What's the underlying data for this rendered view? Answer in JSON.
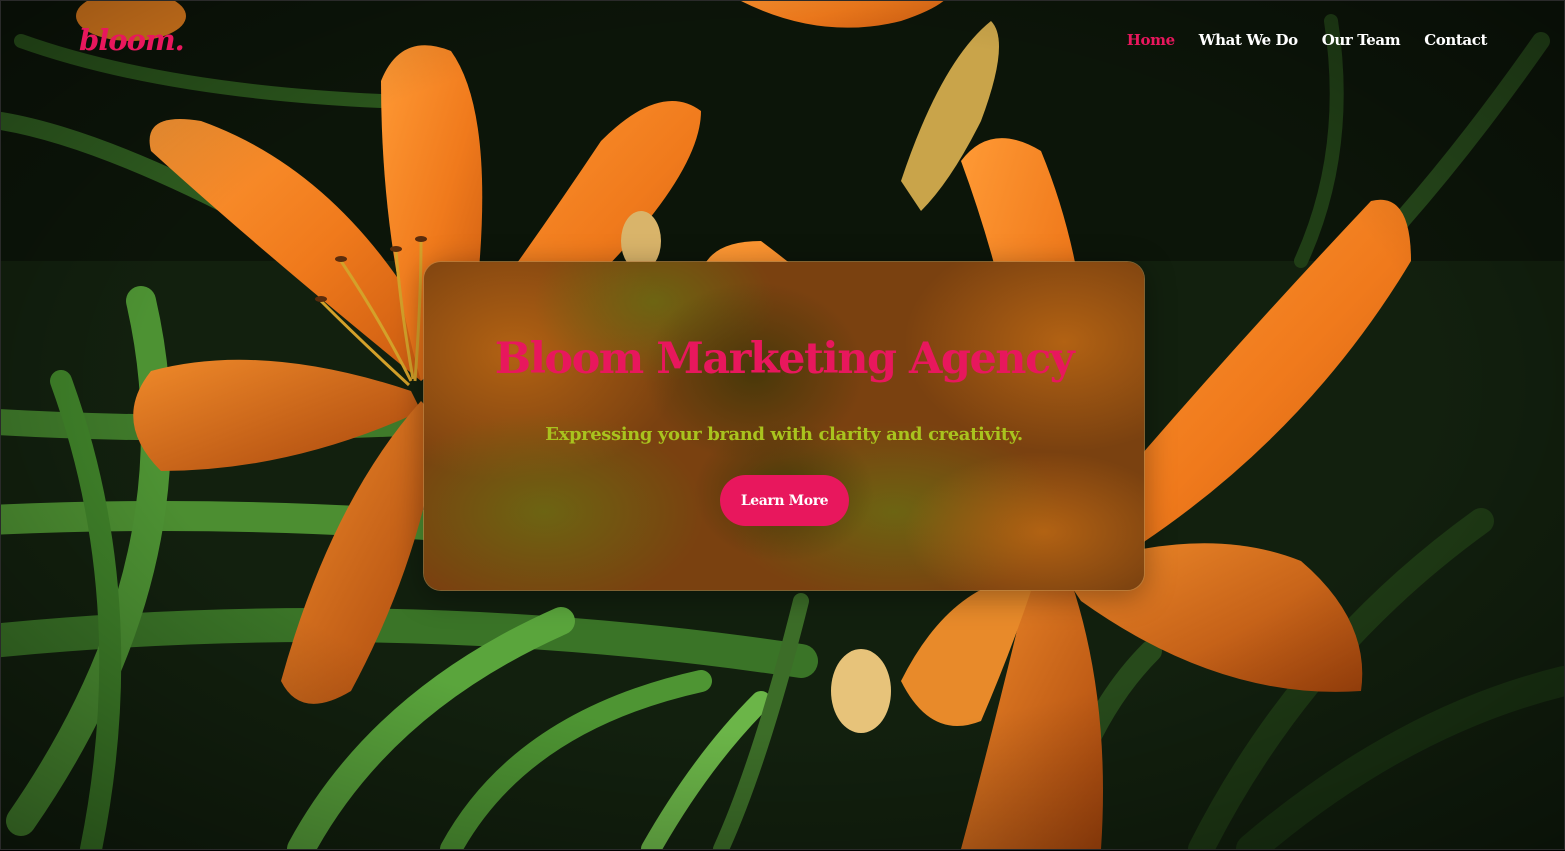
{
  "brand": {
    "logo_text": "bloom.",
    "accent_color": "#e8175d",
    "highlight_color": "#a9c31e"
  },
  "nav": {
    "items": [
      {
        "label": "Home",
        "active": true
      },
      {
        "label": "What We Do",
        "active": false
      },
      {
        "label": "Our Team",
        "active": false
      },
      {
        "label": "Contact",
        "active": false
      }
    ]
  },
  "hero": {
    "background_image": "orange-lily-photo",
    "title": "Bloom Marketing Agency",
    "subtitle": "Expressing your brand with clarity and creativity.",
    "cta_label": "Learn More"
  }
}
